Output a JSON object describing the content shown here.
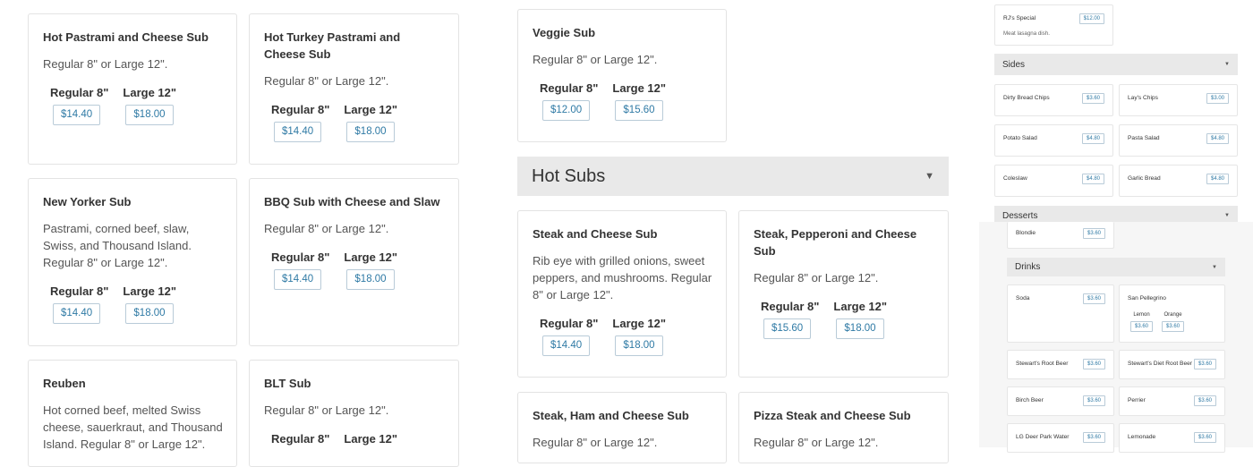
{
  "colors": {
    "accent": "#2f7aa5",
    "header_bg": "#e9e9e9",
    "card_border": "#e3e3e3"
  },
  "price_labels": {
    "regular": "Regular 8\"",
    "large": "Large 12\""
  },
  "left_items": [
    {
      "title": "Hot Pastrami and Cheese Sub",
      "desc": "Regular 8\" or Large 12\".",
      "regular": "$14.40",
      "large": "$18.00"
    },
    {
      "title": "Hot Turkey Pastrami and Cheese Sub",
      "desc": "Regular 8\" or Large 12\".",
      "regular": "$14.40",
      "large": "$18.00"
    },
    {
      "title": "New Yorker Sub",
      "desc": "Pastrami, corned beef, slaw, Swiss, and Thousand Island. Regular 8\" or Large 12\".",
      "regular": "$14.40",
      "large": "$18.00"
    },
    {
      "title": "BBQ Sub with Cheese and Slaw",
      "desc": "Regular 8\" or Large 12\".",
      "regular": "$14.40",
      "large": "$18.00"
    },
    {
      "title": "Reuben",
      "desc": "Hot corned beef, melted Swiss cheese, sauerkraut, and Thousand Island. Regular 8\" or Large 12\"."
    },
    {
      "title": "BLT Sub",
      "desc": "Regular 8\" or Large 12\"."
    }
  ],
  "veggie": {
    "title": "Veggie Sub",
    "desc": "Regular 8\" or Large 12\".",
    "regular": "$12.00",
    "large": "$15.60"
  },
  "hot_subs": {
    "title": "Hot Subs",
    "items": [
      {
        "title": "Steak and Cheese Sub",
        "desc": "Rib eye with grilled onions, sweet peppers, and mushrooms. Regular 8\" or Large 12\".",
        "regular": "$14.40",
        "large": "$18.00"
      },
      {
        "title": "Steak, Pepperoni and Cheese Sub",
        "desc": "Regular 8\" or Large 12\".",
        "regular": "$15.60",
        "large": "$18.00"
      },
      {
        "title": "Steak, Ham and Cheese Sub",
        "desc": "Regular 8\" or Large 12\"."
      },
      {
        "title": "Pizza Steak and Cheese Sub",
        "desc": "Regular 8\" or Large 12\"."
      }
    ]
  },
  "right_panel": {
    "special": {
      "title": "RJ's Special",
      "desc": "Meat lasagna dish.",
      "price": "$12.00"
    },
    "sides": {
      "title": "Sides",
      "items": [
        {
          "title": "Dirty Bread Chips",
          "price": "$3.60"
        },
        {
          "title": "Lay's Chips",
          "price": "$3.00"
        },
        {
          "title": "Potato Salad",
          "price": "$4.80"
        },
        {
          "title": "Pasta Salad",
          "price": "$4.80"
        },
        {
          "title": "Coleslaw",
          "price": "$4.80"
        },
        {
          "title": "Garlic Bread",
          "price": "$4.80"
        }
      ]
    },
    "desserts": {
      "title": "Desserts",
      "items": [
        {
          "title": "Blondie",
          "price": "$3.60"
        }
      ]
    },
    "drinks": {
      "title": "Drinks",
      "items": [
        {
          "title": "Soda",
          "price": "$3.60"
        },
        {
          "title": "San Pellegrino",
          "options": [
            {
              "label": "Lemon",
              "price": "$3.60"
            },
            {
              "label": "Orange",
              "price": "$3.60"
            }
          ]
        },
        {
          "title": "Stewart's Root Beer",
          "price": "$3.60"
        },
        {
          "title": "Stewart's Diet Root Beer",
          "price": "$3.60"
        },
        {
          "title": "Birch Beer",
          "price": "$3.60"
        },
        {
          "title": "Perrier",
          "price": "$3.60"
        },
        {
          "title": "LG Deer Park Water",
          "price": "$3.60"
        },
        {
          "title": "Lemonade",
          "price": "$3.60"
        }
      ]
    }
  }
}
